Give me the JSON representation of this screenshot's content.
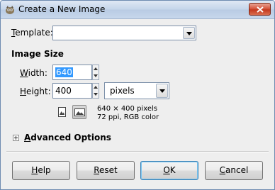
{
  "window": {
    "title": "Create a New Image"
  },
  "template": {
    "label_mnemonic": "T",
    "label_rest": "emplate:",
    "value": ""
  },
  "image_size": {
    "title": "Image Size",
    "width_label_mnemonic": "W",
    "width_label_rest": "idth:",
    "width_value": "640",
    "height_label_mnemonic": "H",
    "height_label_rest": "eight:",
    "height_value": "400",
    "unit": "pixels",
    "info_line1": "640 × 400 pixels",
    "info_line2": "72 ppi, RGB color"
  },
  "advanced": {
    "label_mnemonic": "A",
    "label_rest": "dvanced Options"
  },
  "buttons": {
    "help_mnemonic": "H",
    "help_rest": "elp",
    "reset_mnemonic": "R",
    "reset_rest": "eset",
    "ok_mnemonic": "O",
    "ok_rest": "K",
    "cancel_mnemonic": "C",
    "cancel_rest": "ancel"
  },
  "icons": [
    "gimp-app-icon",
    "close-icon",
    "chevron-down-icon",
    "spin-up-icon",
    "spin-down-icon",
    "portrait-icon",
    "landscape-icon",
    "expander-plus-icon"
  ],
  "colors": {
    "selection": "#3399ff",
    "title_gradient": "#c5d5ea",
    "close_red": "#c4391f"
  }
}
